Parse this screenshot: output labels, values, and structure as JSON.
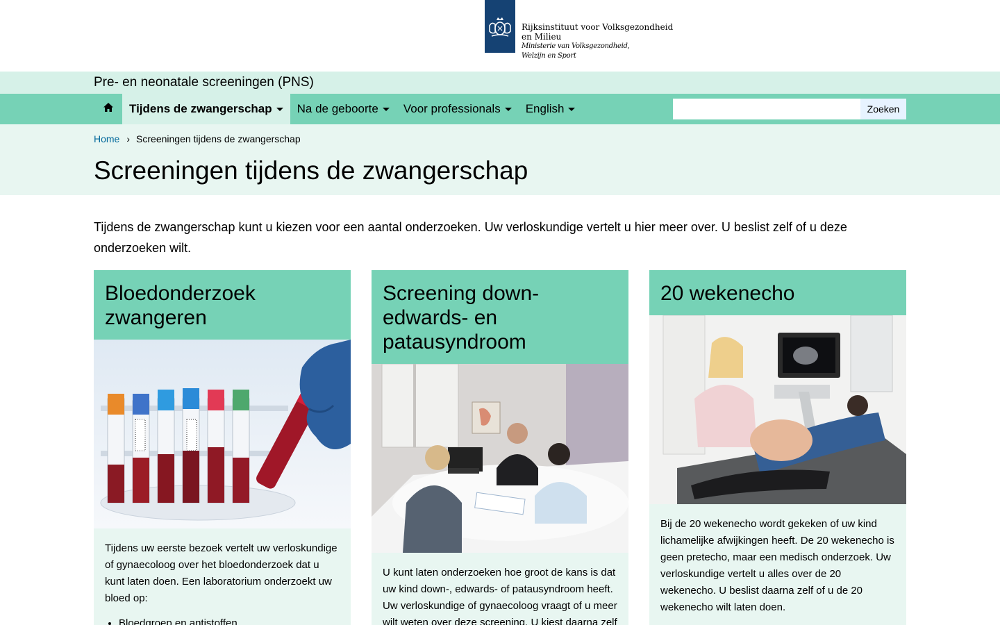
{
  "logo": {
    "org_line1": "Rijksinstituut voor Volksgezondheid",
    "org_line2": "en Milieu",
    "ministry_line1": "Ministerie van Volksgezondheid,",
    "ministry_line2": "Welzijn en Sport"
  },
  "site_title": "Pre- en neonatale screeningen (PNS)",
  "nav": {
    "home_icon": "home-icon",
    "items": [
      {
        "label": "Tijdens de zwangerschap",
        "active": true
      },
      {
        "label": "Na de geboorte",
        "active": false
      },
      {
        "label": "Voor professionals",
        "active": false
      },
      {
        "label": "English",
        "active": false
      }
    ],
    "search_placeholder": "",
    "search_button": "Zoeken"
  },
  "breadcrumb": {
    "home": "Home",
    "separator": "›",
    "current": "Screeningen tijdens de zwangerschap"
  },
  "page_title": "Screeningen tijdens de zwangerschap",
  "intro": "Tijdens de zwangerschap  kunt u kiezen voor een aantal onderzoeken. Uw verloskundige vertelt u hier meer over. U beslist zelf of u deze onderzoeken wilt.",
  "cards": [
    {
      "title_line1": "Bloedonderzoek",
      "title_line2": "zwangeren",
      "image": "blood-sample-tubes-photo",
      "body": "Tijdens uw eerste bezoek vertelt uw verloskundige of gynaecoloog over het bloedonderzoek dat u kunt laten doen.  Een laboratorium onderzoekt uw bloed op:",
      "list_first": "Bloedgroep en antistoffen"
    },
    {
      "title_line1": "Screening down-",
      "title_line2": "edwards- en",
      "title_line3": "patausyndroom",
      "image": "consultation-meeting-photo",
      "body": "U kunt laten onderzoeken hoe groot de kans is dat uw kind down-, edwards- of patausyndroom heeft. Uw verloskundige of gynaecoloog vraagt of u meer wilt weten over deze screening. U kiest daarna zelf"
    },
    {
      "title_line1": "20 wekenecho",
      "image": "ultrasound-examination-photo",
      "body": "Bij de 20 wekenecho wordt gekeken of uw kind lichamelijke afwijkingen heeft. De 20 wekenecho is geen pretecho, maar een medisch onderzoek. Uw verloskundige vertelt u alles over de 20 wekenecho. U beslist daarna zelf of u de 20 wekenecho wilt laten doen."
    }
  ],
  "colors": {
    "primary_green": "#76d2b6",
    "light_green": "#d6f1e8",
    "pale_green": "#e8f6f1",
    "link_blue": "#01689b",
    "logo_blue": "#154273"
  }
}
